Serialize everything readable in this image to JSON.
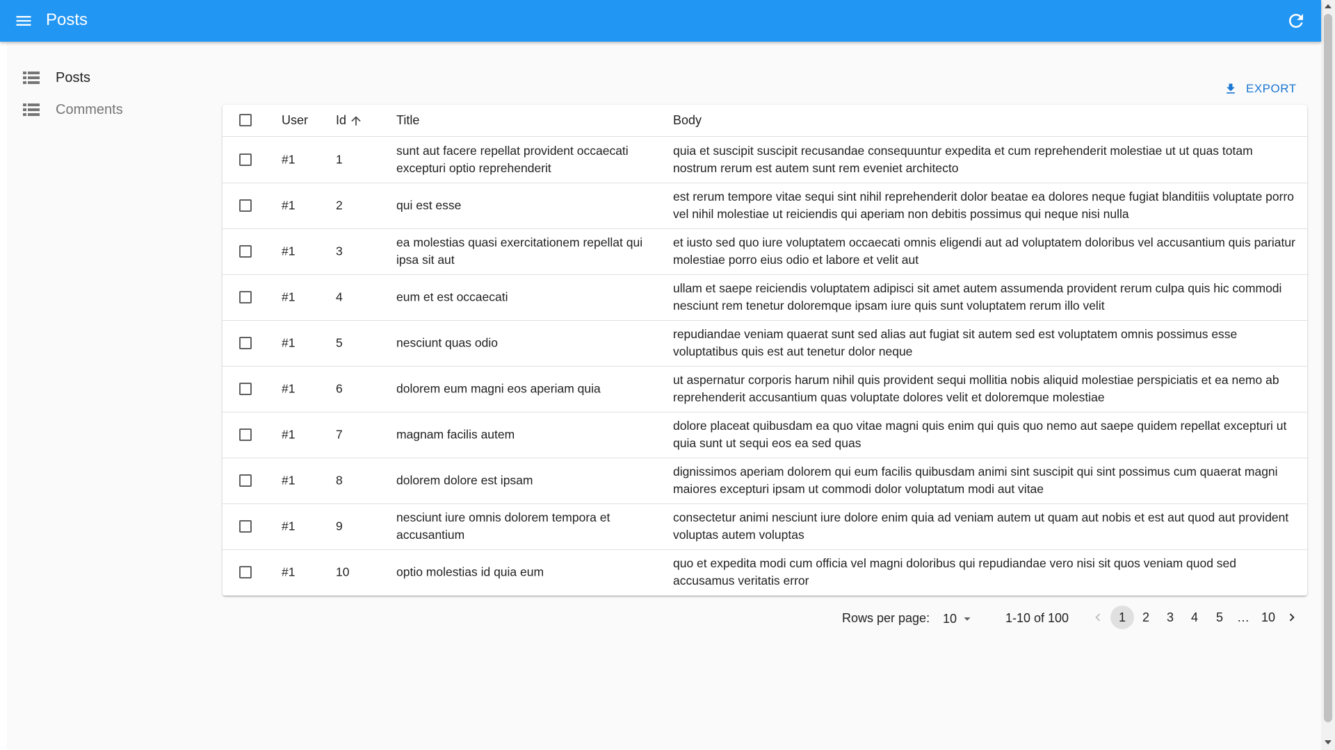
{
  "app": {
    "title": "Posts"
  },
  "sidebar": {
    "items": [
      {
        "label": "Posts"
      },
      {
        "label": "Comments"
      }
    ]
  },
  "toolbar": {
    "export_label": "EXPORT"
  },
  "table": {
    "headers": {
      "user": "User",
      "id": "Id",
      "title": "Title",
      "body": "Body"
    },
    "rows": [
      {
        "user": "#1",
        "id": "1",
        "title": "sunt aut facere repellat provident occaecati excepturi optio reprehenderit",
        "body": "quia et suscipit suscipit recusandae consequuntur expedita et cum reprehenderit molestiae ut ut quas totam nostrum rerum est autem sunt rem eveniet architecto"
      },
      {
        "user": "#1",
        "id": "2",
        "title": "qui est esse",
        "body": "est rerum tempore vitae sequi sint nihil reprehenderit dolor beatae ea dolores neque fugiat blanditiis voluptate porro vel nihil molestiae ut reiciendis qui aperiam non debitis possimus qui neque nisi nulla"
      },
      {
        "user": "#1",
        "id": "3",
        "title": "ea molestias quasi exercitationem repellat qui ipsa sit aut",
        "body": "et iusto sed quo iure voluptatem occaecati omnis eligendi aut ad voluptatem doloribus vel accusantium quis pariatur molestiae porro eius odio et labore et velit aut"
      },
      {
        "user": "#1",
        "id": "4",
        "title": "eum et est occaecati",
        "body": "ullam et saepe reiciendis voluptatem adipisci sit amet autem assumenda provident rerum culpa quis hic commodi nesciunt rem tenetur doloremque ipsam iure quis sunt voluptatem rerum illo velit"
      },
      {
        "user": "#1",
        "id": "5",
        "title": "nesciunt quas odio",
        "body": "repudiandae veniam quaerat sunt sed alias aut fugiat sit autem sed est voluptatem omnis possimus esse voluptatibus quis est aut tenetur dolor neque"
      },
      {
        "user": "#1",
        "id": "6",
        "title": "dolorem eum magni eos aperiam quia",
        "body": "ut aspernatur corporis harum nihil quis provident sequi mollitia nobis aliquid molestiae perspiciatis et ea nemo ab reprehenderit accusantium quas voluptate dolores velit et doloremque molestiae"
      },
      {
        "user": "#1",
        "id": "7",
        "title": "magnam facilis autem",
        "body": "dolore placeat quibusdam ea quo vitae magni quis enim qui quis quo nemo aut saepe quidem repellat excepturi ut quia sunt ut sequi eos ea sed quas"
      },
      {
        "user": "#1",
        "id": "8",
        "title": "dolorem dolore est ipsam",
        "body": "dignissimos aperiam dolorem qui eum facilis quibusdam animi sint suscipit qui sint possimus cum quaerat magni maiores excepturi ipsam ut commodi dolor voluptatum modi aut vitae"
      },
      {
        "user": "#1",
        "id": "9",
        "title": "nesciunt iure omnis dolorem tempora et accusantium",
        "body": "consectetur animi nesciunt iure dolore enim quia ad veniam autem ut quam aut nobis et est aut quod aut provident voluptas autem voluptas"
      },
      {
        "user": "#1",
        "id": "10",
        "title": "optio molestias id quia eum",
        "body": "quo et expedita modi cum officia vel magni doloribus qui repudiandae vero nisi sit quos veniam quod sed accusamus veritatis error"
      }
    ]
  },
  "pagination": {
    "rows_per_page_label": "Rows per page:",
    "rows_per_page_value": "10",
    "range_text": "1-10 of 100",
    "pages": [
      "1",
      "2",
      "3",
      "4",
      "5"
    ],
    "ellipsis": "…",
    "last_page": "10",
    "current_page": "1"
  },
  "colors": {
    "appbar": "#2196f3",
    "accent": "#1976d2"
  },
  "icons": {
    "menu": "menu-icon",
    "refresh": "refresh-icon",
    "list": "list-icon",
    "export": "download-icon",
    "sort": "arrow-up-icon",
    "chevron_left": "chevron-left-icon",
    "chevron_right": "chevron-right-icon",
    "dropdown": "arrow-drop-down-icon"
  }
}
